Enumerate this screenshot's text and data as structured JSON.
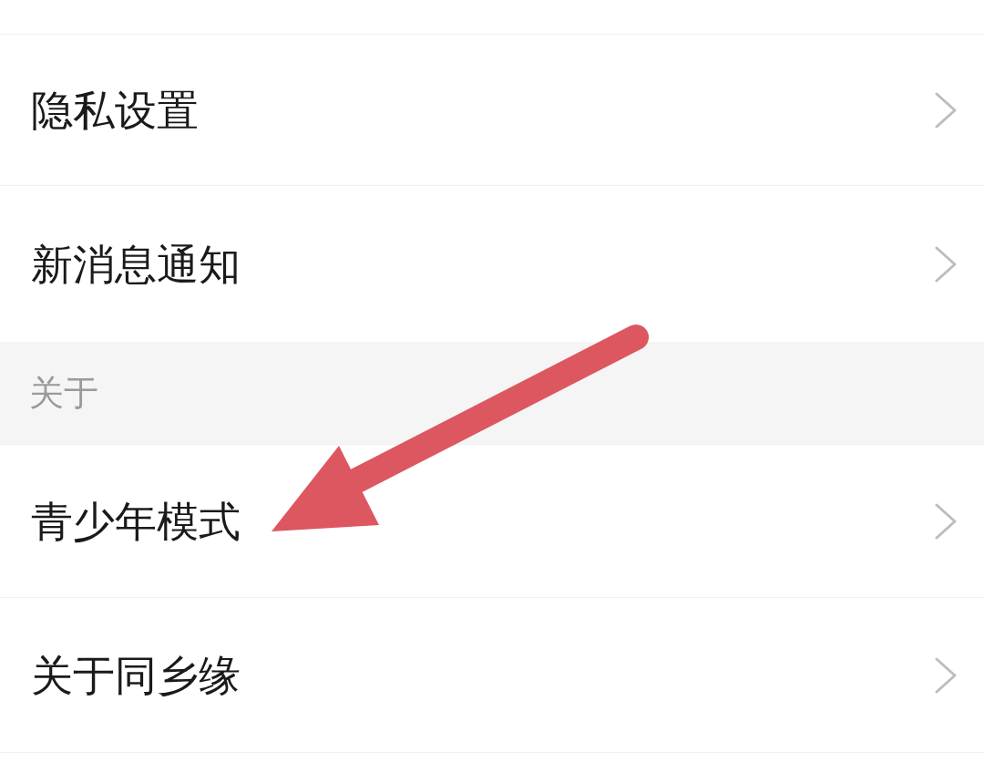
{
  "groups": [
    {
      "items": [
        {
          "label": "隐私设置"
        },
        {
          "label": "新消息通知"
        }
      ]
    },
    {
      "header": "关于",
      "items": [
        {
          "label": "青少年模式"
        },
        {
          "label": "关于同乡缘"
        }
      ]
    }
  ]
}
